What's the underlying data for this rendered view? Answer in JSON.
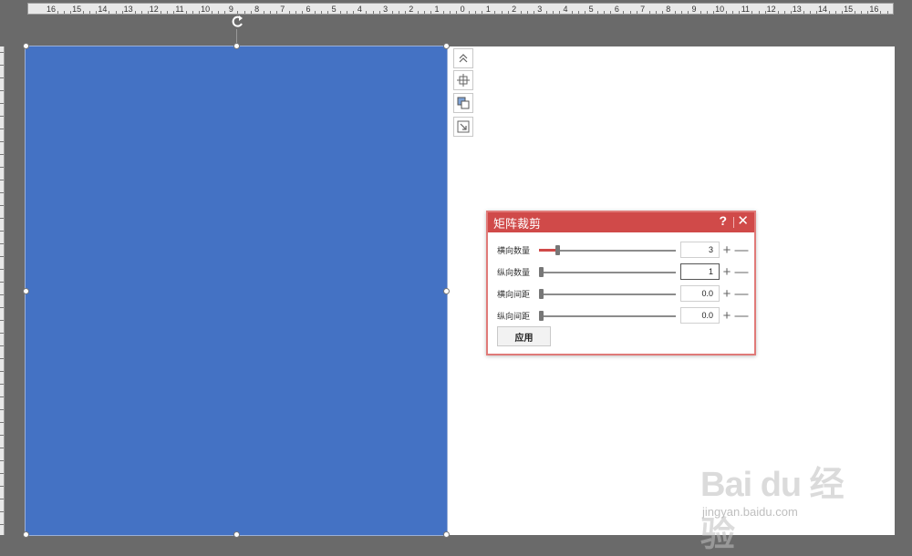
{
  "ruler": {
    "labels": [
      "16",
      "15",
      "14",
      "13",
      "12",
      "11",
      "10",
      "9",
      "8",
      "7",
      "6",
      "5",
      "4",
      "3",
      "2",
      "1",
      "0",
      "1",
      "2",
      "3",
      "4",
      "5",
      "6",
      "7",
      "8",
      "9",
      "10",
      "11",
      "12",
      "13",
      "14",
      "15",
      "16"
    ]
  },
  "dialog": {
    "title": "矩阵裁剪",
    "help_label": "?",
    "close_label": "✕",
    "rows": [
      {
        "label": "横向数量",
        "value": "3",
        "level": 0.12
      },
      {
        "label": "纵向数量",
        "value": "1",
        "level": 0.0
      },
      {
        "label": "横向间距",
        "value": "0.0",
        "level": 0.0
      },
      {
        "label": "纵向间距",
        "value": "0.0",
        "level": 0.0
      }
    ],
    "plus_label": "+",
    "minus_label": "—",
    "apply_label": "应用"
  },
  "watermark": {
    "logo": "Bai du 经验",
    "url": "jingyan.baidu.com"
  },
  "colors": {
    "shape_fill": "#4472c4",
    "dialog_accent": "#d04a49",
    "workspace": "#6a6a6a"
  }
}
